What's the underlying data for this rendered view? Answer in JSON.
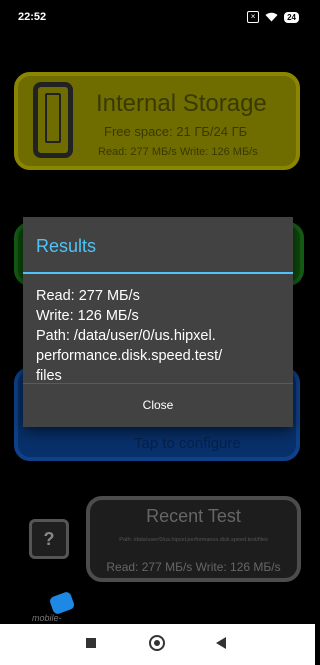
{
  "status_bar": {
    "time": "22:52",
    "battery": "24"
  },
  "storage_card": {
    "title": "Internal Storage",
    "free_space": "Free space: 21 ГБ/24 ГБ",
    "speed": "Read: 277 МБ/s Write: 126 МБ/s"
  },
  "configure_card": {
    "label": "Tap to configure"
  },
  "help_button": {
    "label": "?"
  },
  "recent_test": {
    "title": "Recent Test",
    "path": "Path: /data/user/0/us.hipxel.performance.disk.speed.test/files",
    "speed": "Read: 277 МБ/s Write: 126 МБ/s"
  },
  "watermark": {
    "text": "mobile-review.com"
  },
  "dialog": {
    "title": "Results",
    "read": "Read: 277 МБ/s",
    "write": "Write: 126 МБ/s",
    "path": "Path: /data/user/0/us.hipxel.\nperformance.disk.speed.test/\nfiles",
    "close_label": "Close",
    "accent_color": "#4fc3f7"
  }
}
